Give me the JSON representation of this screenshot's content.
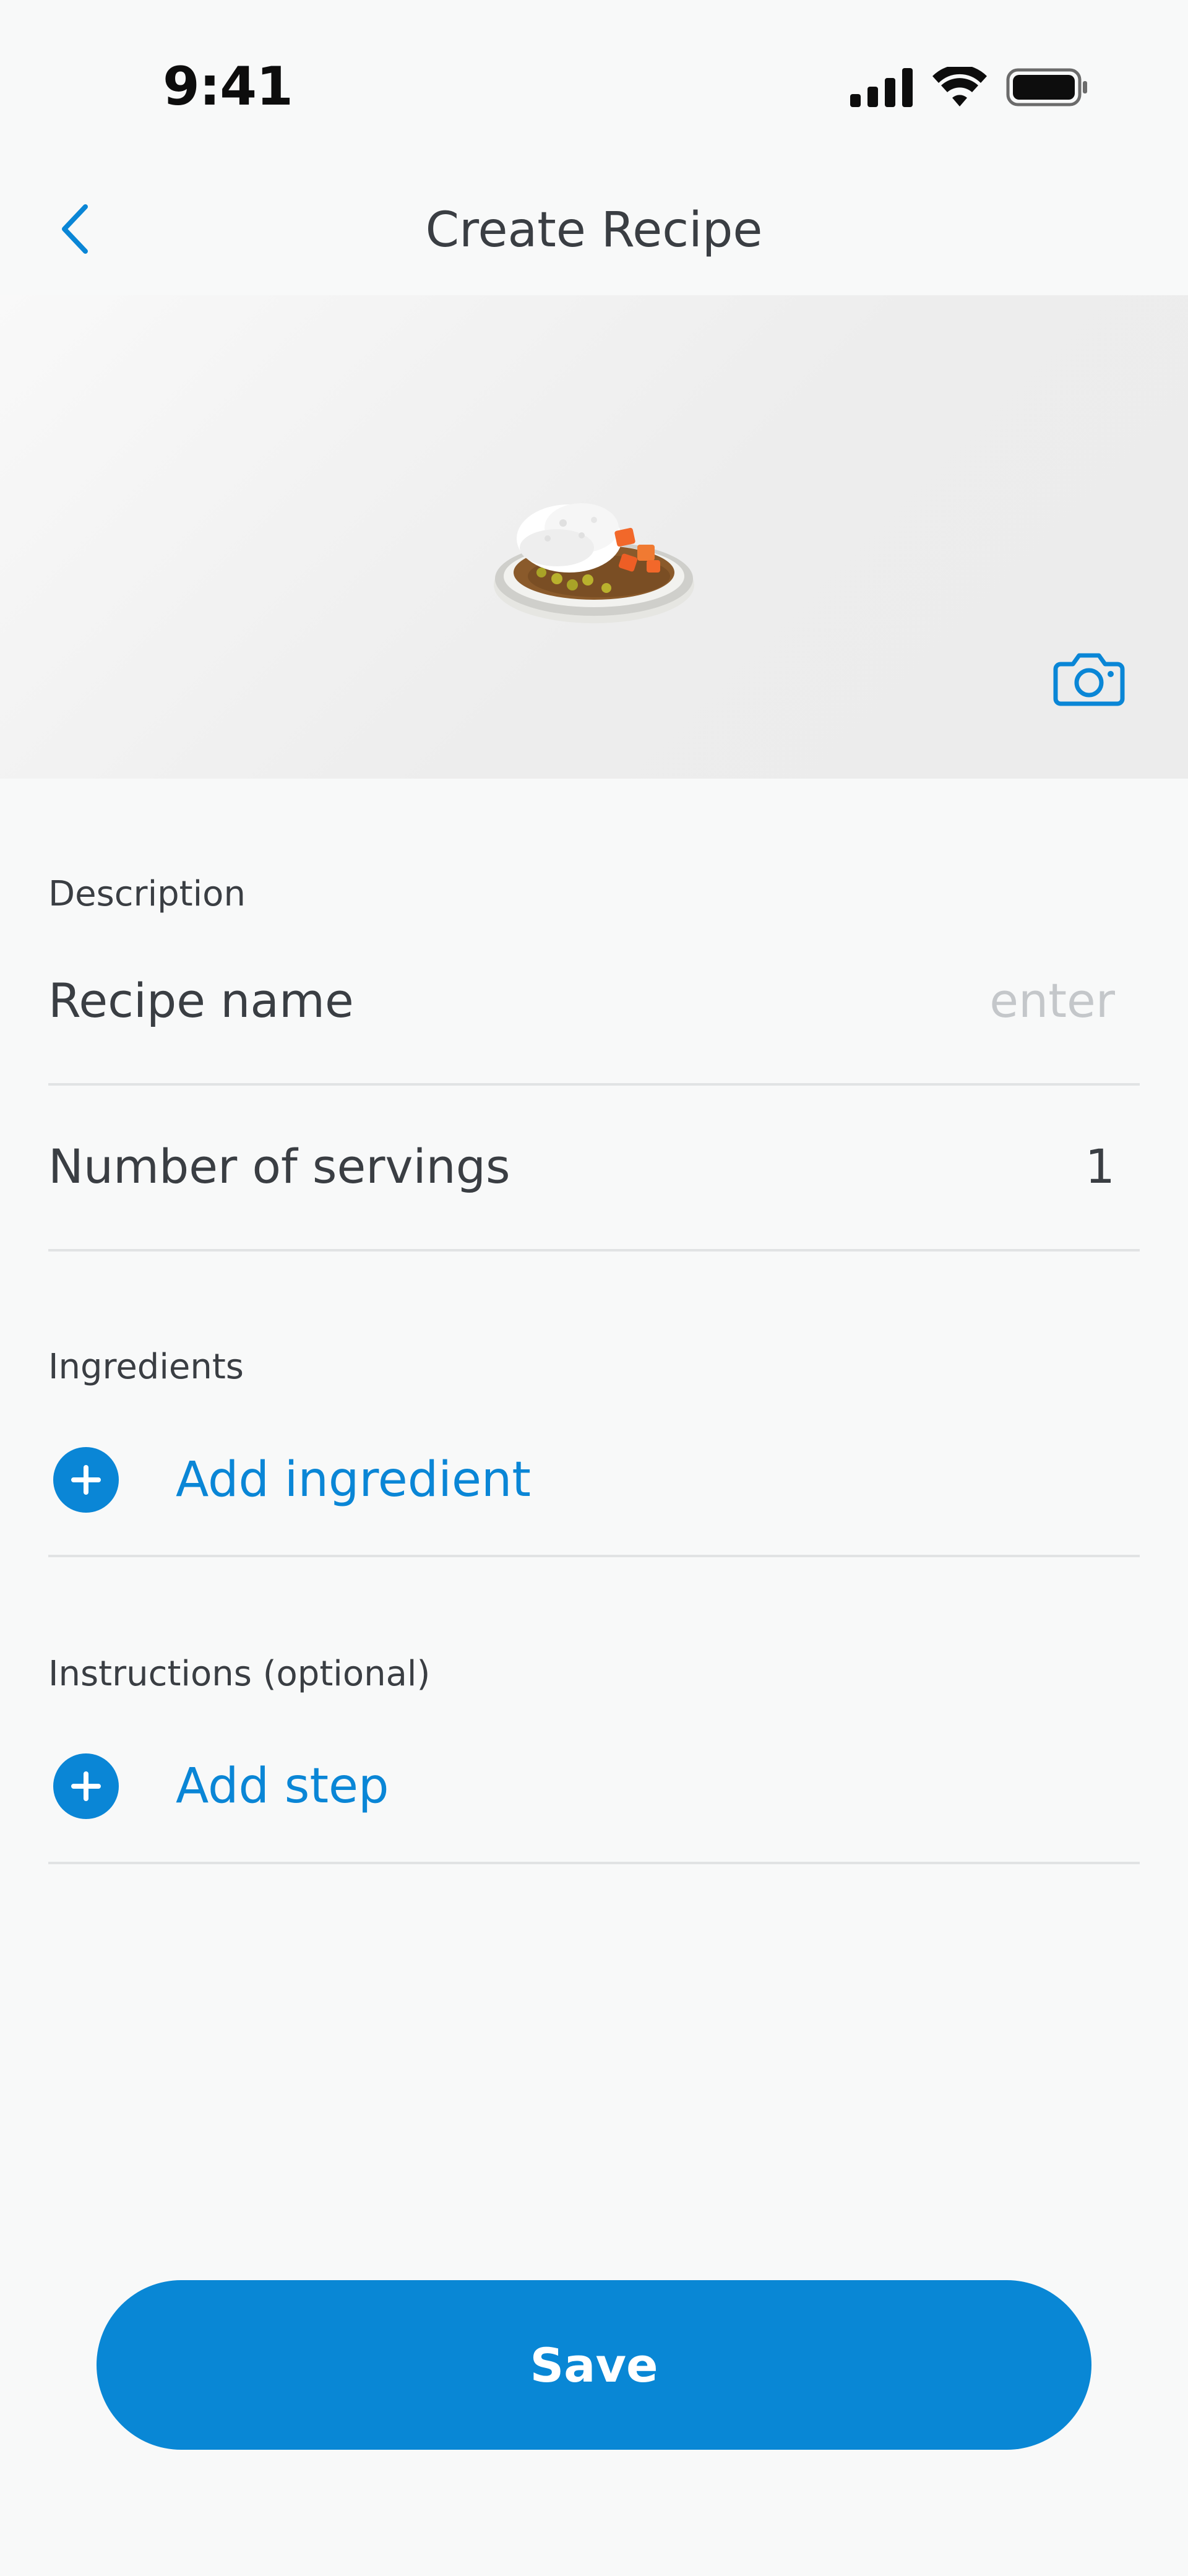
{
  "status_bar": {
    "time": "9:41"
  },
  "nav": {
    "title": "Create Recipe",
    "back_icon": "chevron-left-icon"
  },
  "hero": {
    "image": "curry-rice-dish",
    "camera_icon": "camera-icon"
  },
  "description": {
    "section_label": "Description",
    "recipe_name_label": "Recipe name",
    "recipe_name_placeholder": "enter",
    "servings_label": "Number of servings",
    "servings_value": "1"
  },
  "ingredients": {
    "section_label": "Ingredients",
    "add_label": "Add ingredient",
    "add_icon": "plus-circle-icon"
  },
  "instructions": {
    "section_label": "Instructions (optional)",
    "add_label": "Add step",
    "add_icon": "plus-circle-icon"
  },
  "actions": {
    "save_label": "Save"
  },
  "colors": {
    "accent": "#0A86D6",
    "background": "#F8F9F9",
    "text": "#3A3E43",
    "divider": "#E1E3E4",
    "placeholder": "#C4C7CA"
  }
}
